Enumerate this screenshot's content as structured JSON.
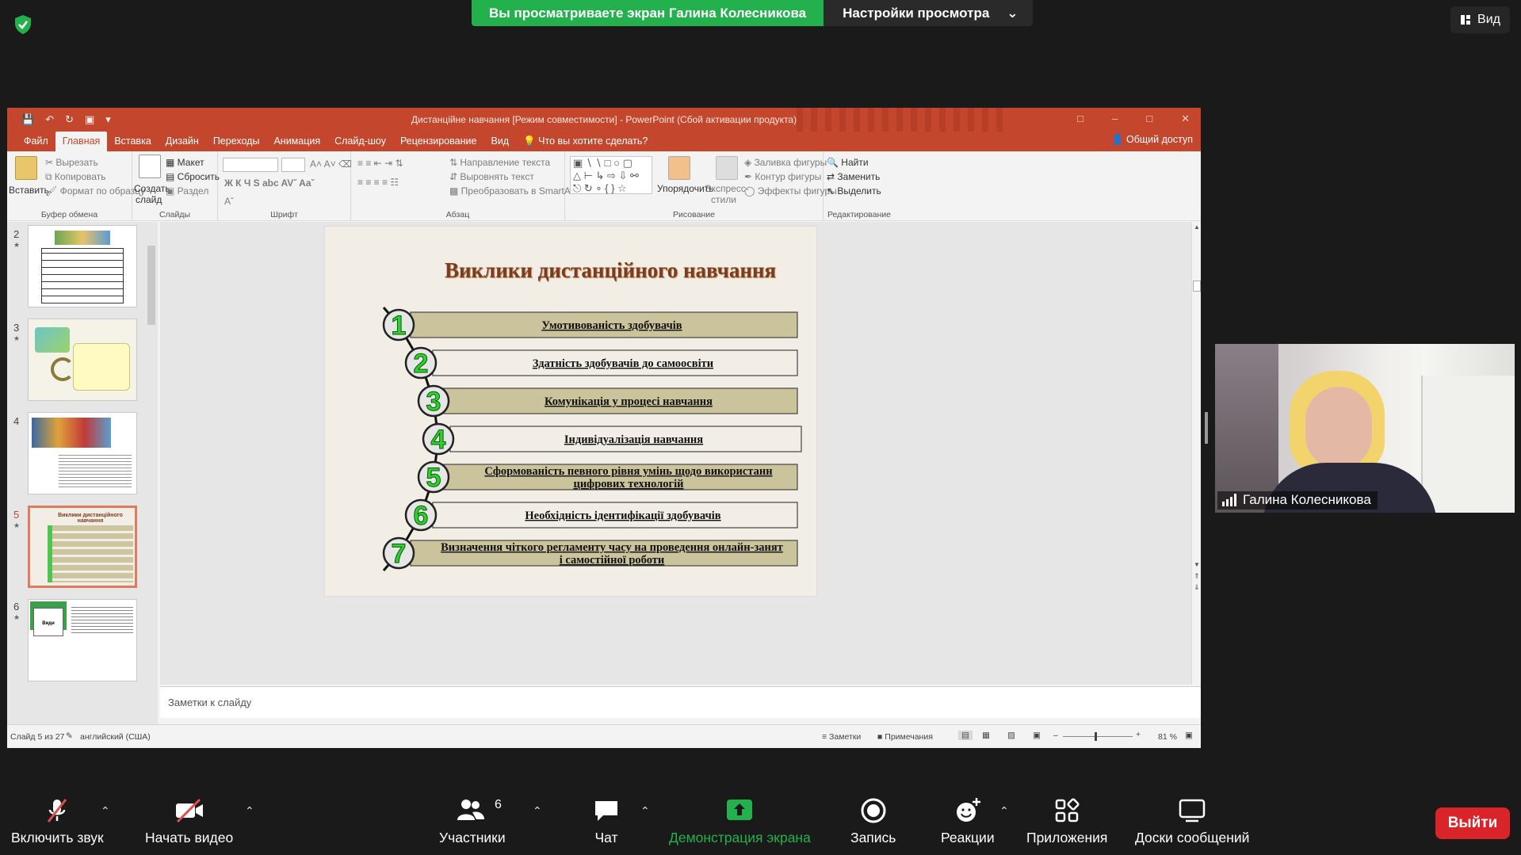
{
  "zoom": {
    "banner": {
      "sharing_text": "Вы просматриваете экран Галина Колесникова",
      "settings_label": "Настройки просмотра"
    },
    "view_label": "Вид",
    "participant": {
      "name": "Галина Колесникова"
    },
    "controls": {
      "audio": "Включить звук",
      "video": "Начать видео",
      "participants": "Участники",
      "participants_count": "6",
      "chat": "Чат",
      "share": "Демонстрация экрана",
      "record": "Запись",
      "reactions": "Реакции",
      "apps": "Приложения",
      "whiteboards": "Доски сообщений",
      "leave": "Выйти"
    },
    "colors": {
      "share_green": "#23b14d",
      "leave_red": "#d9252a",
      "background": "#1a1a1a"
    }
  },
  "ppt": {
    "title": "Дистанційне навчання [Режим совместимости] - PowerPoint (Сбой активации продукта)",
    "tabs": [
      "Файл",
      "Главная",
      "Вставка",
      "Дизайн",
      "Переходы",
      "Анимация",
      "Слайд-шоу",
      "Рецензирование",
      "Вид"
    ],
    "tell_me": "Что вы хотите сделать?",
    "share_access": "Общий доступ",
    "ribbon": {
      "clipboard": {
        "paste": "Вставить",
        "cut": "Вырезать",
        "copy": "Копировать",
        "format_painter": "Формат по образцу",
        "label": "Буфер обмена"
      },
      "slides": {
        "new_slide_1": "Создать",
        "new_slide_2": "слайд",
        "layout": "Макет",
        "reset": "Сбросить",
        "section": "Раздел",
        "label": "Слайды"
      },
      "font": {
        "label": "Шрифт"
      },
      "paragraph": {
        "text_direction": "Направление текста",
        "align_text": "Выровнять текст",
        "smartart": "Преобразовать в SmartArt",
        "label": "Абзац"
      },
      "drawing": {
        "arrange": "Упорядочить",
        "quick_styles_1": "Экспресс-",
        "quick_styles_2": "стили",
        "fill": "Заливка фигуры",
        "outline": "Контур фигуры",
        "effects": "Эффекты фигуры",
        "label": "Рисование"
      },
      "editing": {
        "find": "Найти",
        "replace": "Заменить",
        "select": "Выделить",
        "label": "Редактирование"
      }
    },
    "slide_numbers": [
      "2",
      "3",
      "4",
      "5",
      "6"
    ],
    "thumb5_title": "Виклики дистанційного навчання",
    "thumb6_title": "Види",
    "slide": {
      "title": "Виклики дистанційного навчання",
      "items": [
        {
          "num": "1",
          "text": "Умотивованість  здобувачів"
        },
        {
          "num": "2",
          "text": "Здатність здобувачів до самоосвіти"
        },
        {
          "num": "3",
          "text": "Комунікація  у процесі навчання"
        },
        {
          "num": "4",
          "text": "Індивідуалізація навчання"
        },
        {
          "num": "5",
          "text": "Сформованість певного рівня умінь щодо використання цифрових технологій"
        },
        {
          "num": "6",
          "text": "Необхідність ідентифікації здобувачів"
        },
        {
          "num": "7",
          "text": "Визначення чіткого регламенту часу на проведення онлайн-занять і самостійної роботи"
        }
      ]
    },
    "notes_placeholder": "Заметки к слайду",
    "status": {
      "slide_counter": "Слайд 5 из 27",
      "language": "английский (США)",
      "notes": "Заметки",
      "comments": "Примечания",
      "zoom": "81 %"
    },
    "colors": {
      "accent": "#c4472d"
    }
  }
}
